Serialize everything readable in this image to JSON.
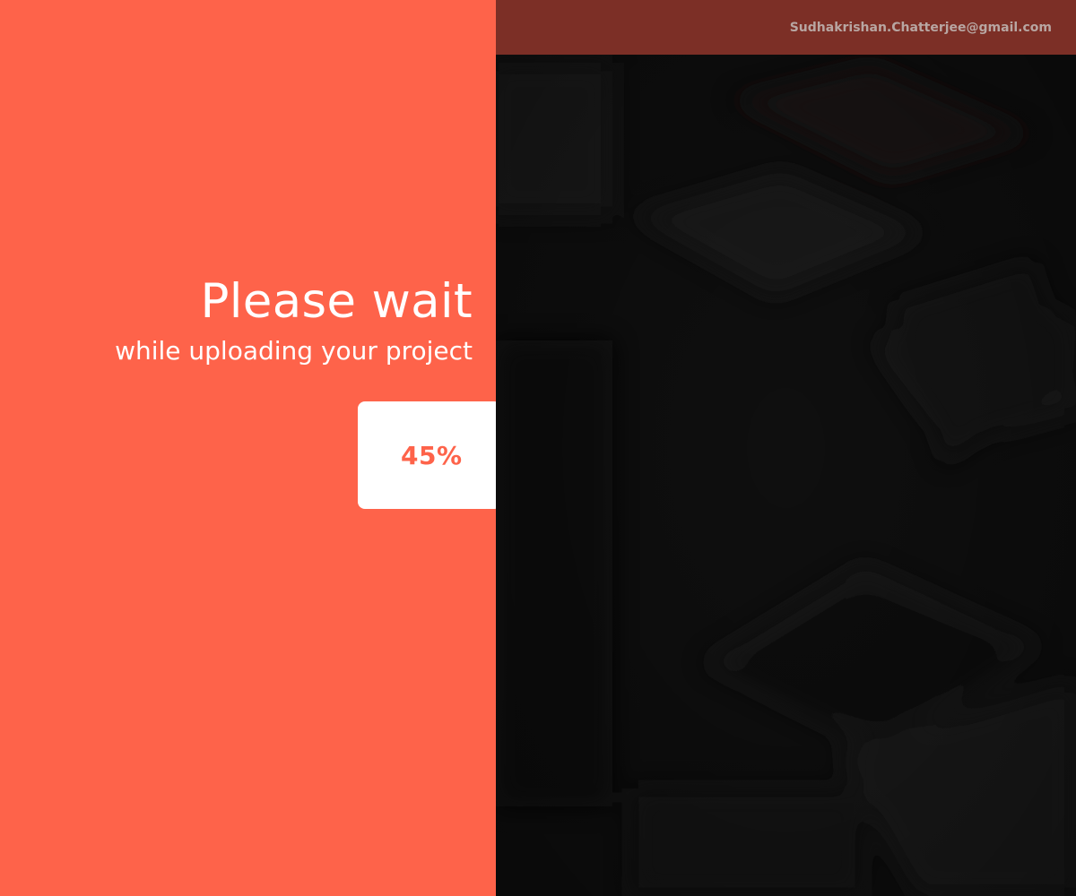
{
  "header": {
    "user_email": "Sudhakrishan.Chatterjee@gmail.com"
  },
  "upload": {
    "title": "Please wait",
    "subtitle": "while uploading your project",
    "progress_label": "45%",
    "progress_fraction": 0.45
  },
  "background": {
    "image": "blurred-desk-photo"
  },
  "colors": {
    "accent": "#fe634a",
    "header_bar": "#7c2f26",
    "card": "#ffffff",
    "dark_panel": "#0d0d0d",
    "email_text": "#b8a6a2"
  }
}
